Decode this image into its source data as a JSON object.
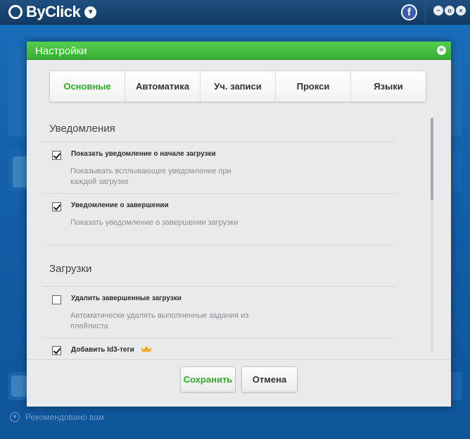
{
  "app": {
    "name": "ByClick",
    "facebook_glyph": "f",
    "window_buttons": [
      "−",
      "o",
      "×"
    ],
    "recommended_label": "Рекомендовано вам"
  },
  "dialog": {
    "title": "Настройки",
    "close_glyph": "×",
    "tabs": [
      {
        "label": "Основные",
        "active": true
      },
      {
        "label": "Автоматика",
        "active": false
      },
      {
        "label": "Уч. записи",
        "active": false
      },
      {
        "label": "Прокси",
        "active": false
      },
      {
        "label": "Языки",
        "active": false
      }
    ],
    "sections": {
      "notifications": {
        "title": "Уведомления",
        "options": [
          {
            "label": "Показать уведомление о начале загрузки",
            "description": "Показывать всплывающее уведомление при каждой загрузке",
            "checked": true
          },
          {
            "label": "Уведомление о завершении",
            "description": "Показать уведомление о завершении загрузки",
            "checked": true
          }
        ]
      },
      "downloads": {
        "title": "Загрузки",
        "options": [
          {
            "label": "Удалить завершенные загрузки",
            "description": "Автоматически удалять выполненные задания из плейлиста",
            "checked": false
          },
          {
            "label": "Добавить Id3-теги",
            "description": "",
            "checked": true,
            "premium_icon": "crown-icon"
          }
        ]
      }
    },
    "buttons": {
      "save": "Сохранить",
      "cancel": "Отмена"
    }
  },
  "colors": {
    "accent_green": "#36a52f",
    "header_green": "#45bf3e",
    "app_blue": "#135fa9",
    "premium_gold": "#f0a816"
  }
}
